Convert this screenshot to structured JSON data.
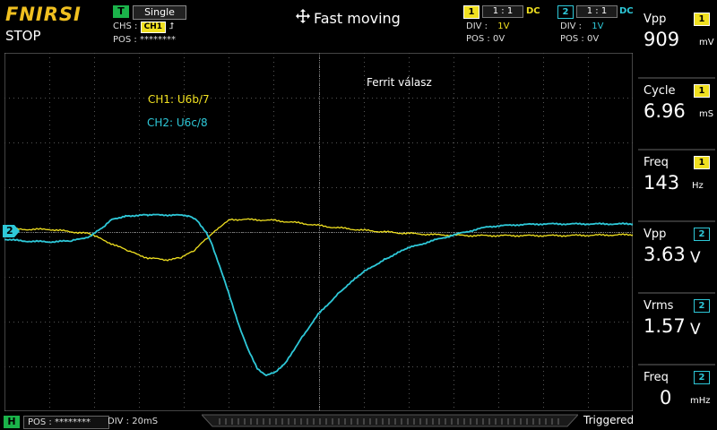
{
  "brand": "FNIRSI",
  "state": "STOP",
  "trigger": {
    "badge": "T",
    "mode": "Single",
    "source_label": "CHS :",
    "source_channel": "CH1",
    "edge_symbol": "⮥",
    "pos_label": "POS :",
    "pos_value": "********"
  },
  "title": "Fast moving",
  "channels": [
    {
      "num": "1",
      "ratio": "1 : 1",
      "coupling": "DC",
      "div_label": "DIV :",
      "div_value": "1V",
      "pos_label": "POS :",
      "pos_value": "0V",
      "color": "#f0e020"
    },
    {
      "num": "2",
      "ratio": "1 : 1",
      "coupling": "DC",
      "div_label": "DIV :",
      "div_value": "1V",
      "pos_label": "POS :",
      "pos_value": "0V",
      "color": "#2ec8d8"
    }
  ],
  "measurements": [
    {
      "name": "Vpp",
      "channel": "1",
      "value": "909",
      "unit": "mV"
    },
    {
      "name": "Cycle",
      "channel": "1",
      "value": "6.96",
      "unit": "mS"
    },
    {
      "name": "Freq",
      "channel": "1",
      "value": "143",
      "unit": "Hz"
    },
    {
      "name": "Vpp",
      "channel": "2",
      "value": "3.63",
      "unit": "V"
    },
    {
      "name": "Vrms",
      "channel": "2",
      "value": "1.57",
      "unit": "V"
    },
    {
      "name": "Freq",
      "channel": "2",
      "value": "0",
      "unit": "mHz"
    }
  ],
  "annotations": {
    "main": "Ferrit válasz",
    "ch1": "CH1: U6b/7",
    "ch2": "CH2: U6c/8"
  },
  "marker_ch2": "2",
  "bottom": {
    "h_badge": "H",
    "pos_label": "POS :",
    "pos_value": "********",
    "div_label": "DIV :",
    "div_value": "20mS",
    "status": "Triggered"
  },
  "colors": {
    "ch1": "#f0e020",
    "ch2": "#2ec8d8",
    "trigger": "#1bb34a",
    "brand": "#f0c020"
  }
}
